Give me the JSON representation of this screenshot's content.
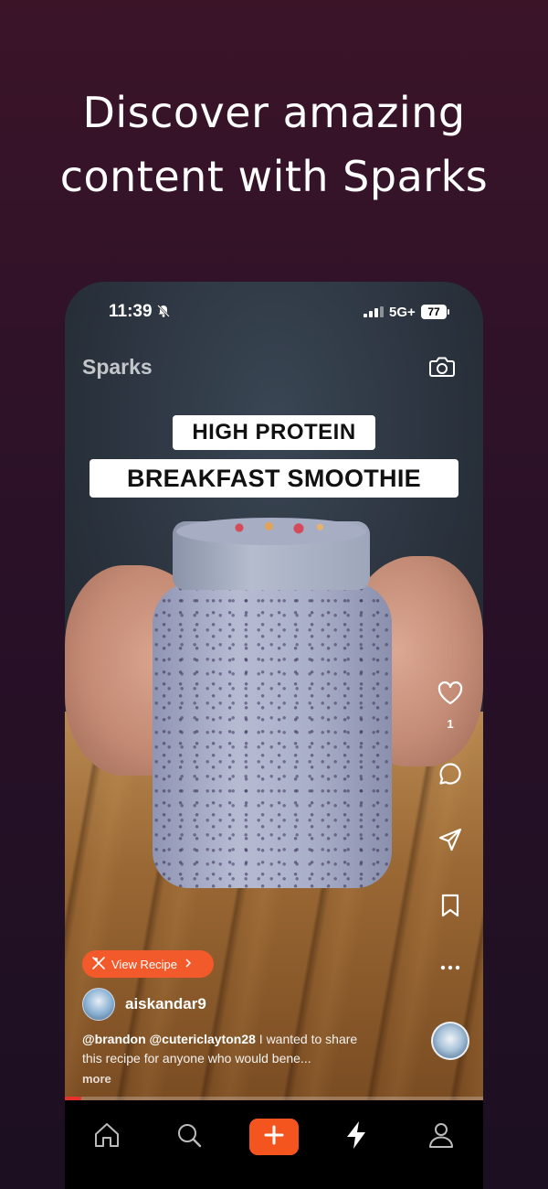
{
  "promo": {
    "headline_line1": "Discover amazing",
    "headline_line2": "content with Sparks"
  },
  "status_bar": {
    "time": "11:39",
    "network": "5G+",
    "battery": "77"
  },
  "header": {
    "app_name": "Sparks",
    "camera_icon": "camera-icon"
  },
  "video": {
    "title_line1": "HIGH PROTEIN",
    "title_line2": "BREAKFAST SMOOTHIE",
    "progress_fraction": 0.04
  },
  "actions": {
    "like_count": "1",
    "icons": [
      "heart-icon",
      "comment-icon",
      "share-icon",
      "bookmark-icon",
      "more-icon"
    ]
  },
  "post": {
    "recipe_button_label": "View Recipe",
    "author": "aiskandar9",
    "caption_mentions": "@brandon @cutericlayton28",
    "caption_text": " I wanted to share this recipe for anyone who would bene...",
    "more_label": "more"
  },
  "tab_bar": {
    "items": [
      "home-icon",
      "search-icon",
      "create-icon",
      "sparks-icon",
      "profile-icon"
    ]
  },
  "colors": {
    "accent": "#f4541e",
    "progress": "#e8322e",
    "background_top": "#3b1428",
    "background_bottom": "#1c0f22"
  }
}
